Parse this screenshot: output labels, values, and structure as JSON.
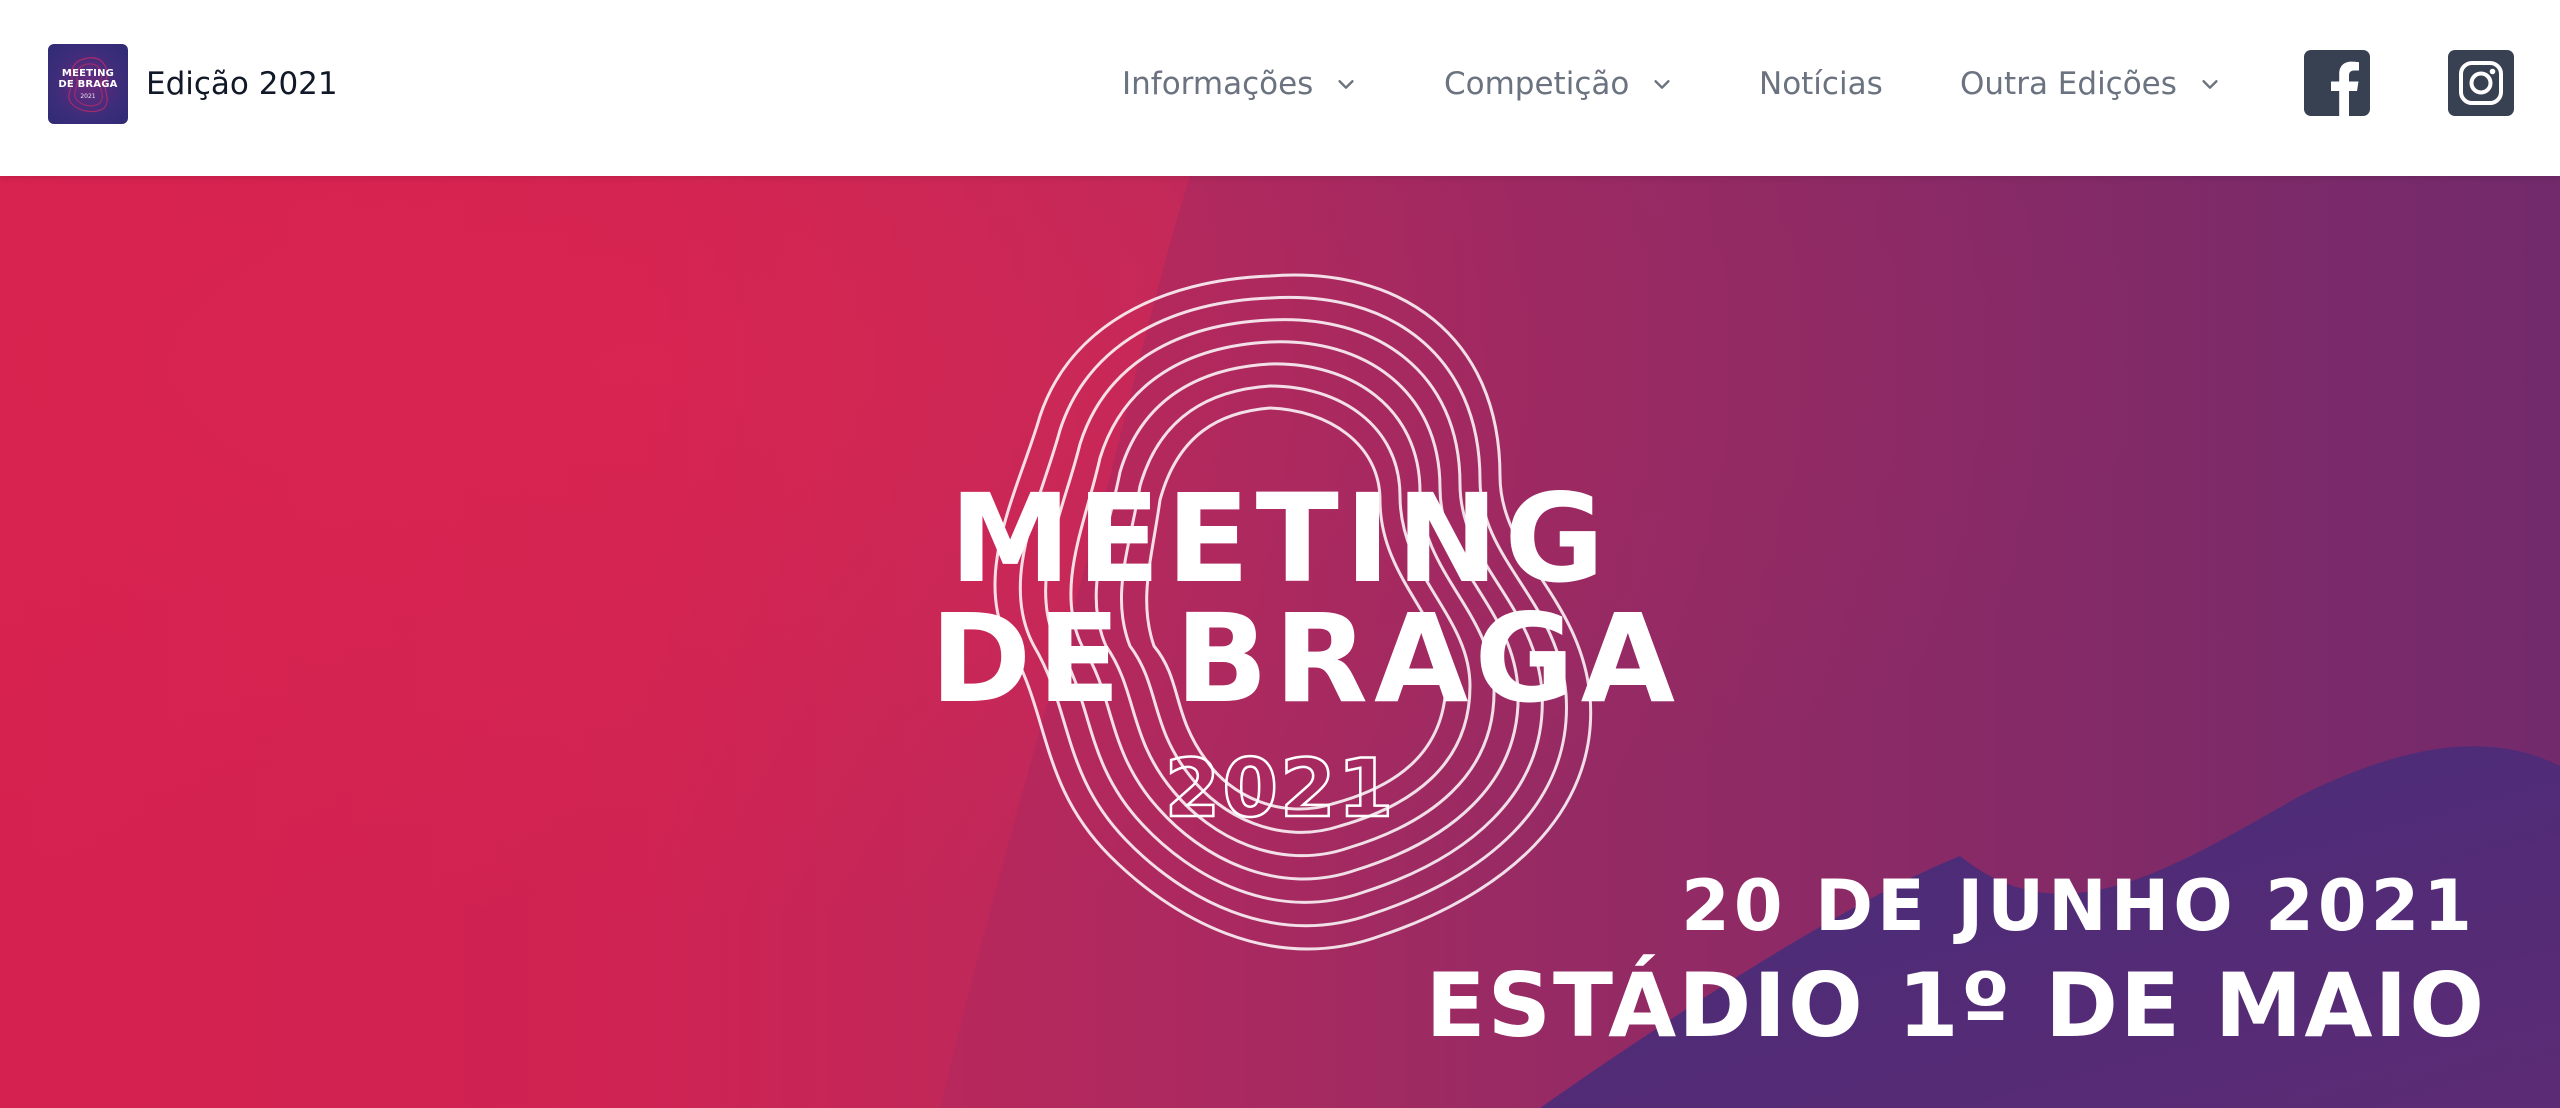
{
  "header": {
    "brand": {
      "logo_text_line1": "MEETING",
      "logo_text_line2": "DE BRAGA",
      "logo_text_year": "2021",
      "title": "Edição 2021"
    },
    "nav": [
      {
        "label": "Informações",
        "has_dropdown": true,
        "icon": "chevron-down-icon"
      },
      {
        "label": "Competição",
        "has_dropdown": true,
        "icon": "chevron-down-icon"
      },
      {
        "label": "Notícias",
        "has_dropdown": false
      },
      {
        "label": "Outra Edições",
        "has_dropdown": true,
        "icon": "chevron-down-icon"
      }
    ],
    "social": [
      {
        "icon": "facebook-icon"
      },
      {
        "icon": "instagram-icon"
      }
    ]
  },
  "hero": {
    "title_line1": "MEETING",
    "title_line2": "DE BRAGA",
    "year": "2021",
    "date": "20 DE JUNHO 2021",
    "venue": "ESTÁDIO 1º DE MAIO"
  },
  "colors": {
    "header_bg": "#ffffff",
    "nav_text": "#6b7280",
    "brand_text": "#111827",
    "social_icon": "#374151",
    "hero_left": "#d5214f",
    "hero_right": "#772a6b",
    "hero_accent_purple": "#4a2c7a",
    "hero_text": "#ffffff"
  }
}
